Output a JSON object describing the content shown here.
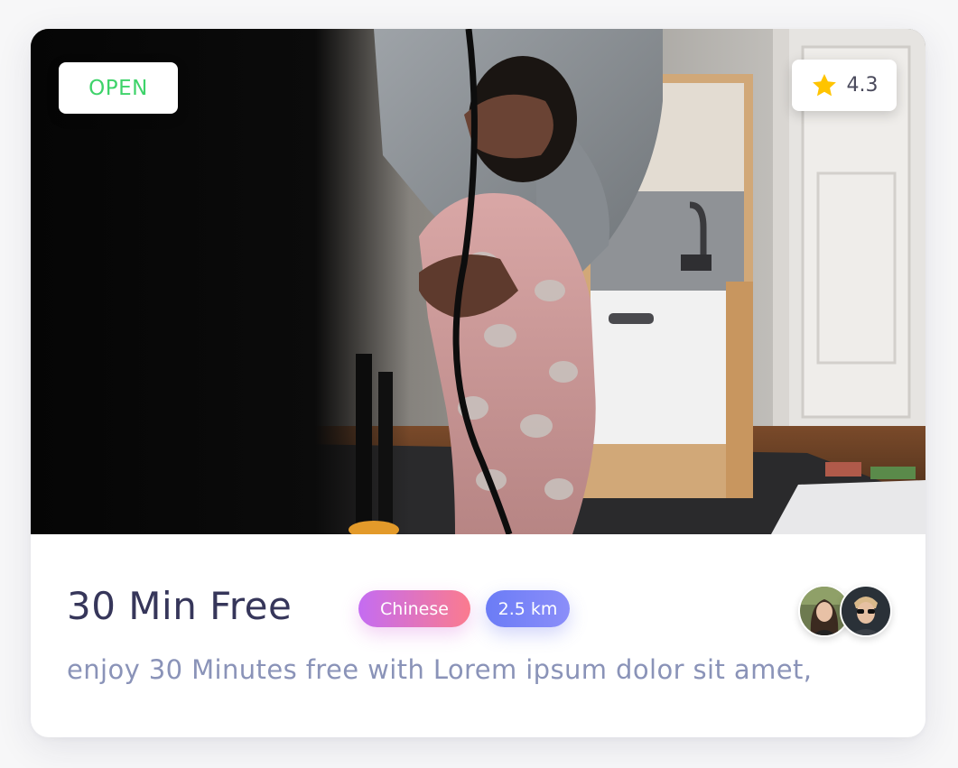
{
  "card": {
    "status": "OPEN",
    "rating": "4.3",
    "title": "30 Min Free",
    "tags": {
      "cuisine": "Chinese",
      "distance": "2.5 km"
    },
    "description": "enjoy 30 Minutes free with Lorem ipsum dolor sit amet,",
    "image_description": "A parent holding a toddler in pink bunny pajamas in a dim kitchen",
    "icons": {
      "rating": "star-icon"
    },
    "avatars": [
      {
        "name": "avatar-woman"
      },
      {
        "name": "avatar-man"
      }
    ]
  },
  "colors": {
    "status_open": "#3ed36a",
    "star": "#ffc400",
    "title": "#36365a",
    "description": "#8a93b8",
    "tag_cuisine_start": "#c46cf2",
    "tag_cuisine_end": "#fb7b8e",
    "tag_distance_start": "#6b7cf6",
    "tag_distance_end": "#8b8ef9"
  }
}
